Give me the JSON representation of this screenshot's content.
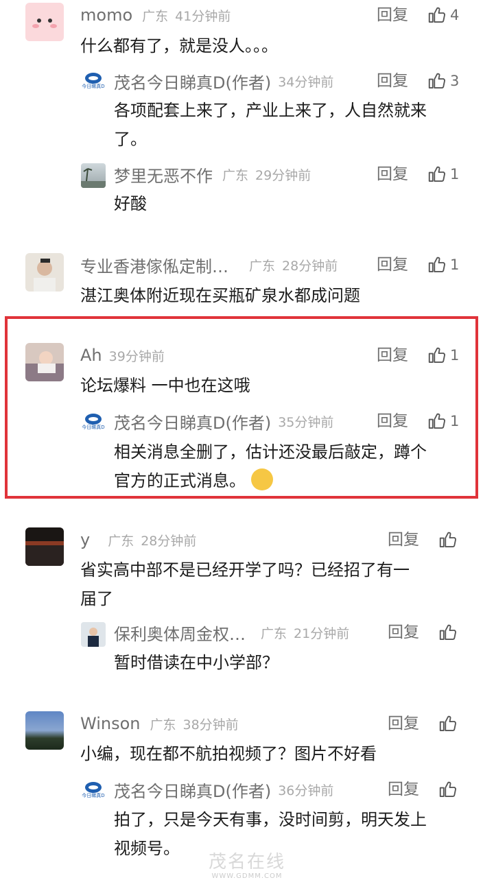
{
  "reply_label": "回复",
  "comments": [
    {
      "user": "momo",
      "region": "广东",
      "time": "41分钟前",
      "likes": "4",
      "text": "什么都有了，就是没人。。。",
      "replies": [
        {
          "user": "茂名今日睇真D(作者)",
          "region": "",
          "time": "34分钟前",
          "likes": "3",
          "text_line1": "各项配套上来了，产业上来了，人自然就来",
          "text_line2": "了。"
        },
        {
          "user": "梦里无恶不作",
          "region": "广东",
          "time": "29分钟前",
          "likes": "1",
          "text": "好酸"
        }
      ]
    },
    {
      "user": "专业香港傢俬定制…",
      "region": "广东",
      "time": "28分钟前",
      "likes": "1",
      "text": "湛江奥体附近现在买瓶矿泉水都成问题"
    },
    {
      "user": "Ah",
      "region": "",
      "time": "39分钟前",
      "likes": "1",
      "text": "论坛爆料 一中也在这哦",
      "replies": [
        {
          "user": "茂名今日睇真D(作者)",
          "region": "",
          "time": "35分钟前",
          "likes": "1",
          "text_line1": "相关消息全删了，估计还没最后敲定，蹲个",
          "text_line2": "官方的正式消息。"
        }
      ]
    },
    {
      "user": "y",
      "region": "广东",
      "time": "28分钟前",
      "likes": "",
      "text_line1": "省实高中部不是已经开学了吗？已经招了有一",
      "text_line2": "届了",
      "replies": [
        {
          "user": "保利奥体周金权…",
          "region": "广东",
          "time": "21分钟前",
          "likes": "",
          "text": "暂时借读在中小学部？"
        }
      ]
    },
    {
      "user": "Winson",
      "region": "广东",
      "time": "38分钟前",
      "likes": "",
      "text": "小编，现在都不航拍视频了？图片不好看",
      "replies": [
        {
          "user": "茂名今日睇真D(作者)",
          "region": "",
          "time": "36分钟前",
          "likes": "",
          "text_line1": "拍了，只是今天有事，没时间剪，明天发上",
          "text_line2": "视频号。"
        }
      ]
    }
  ],
  "author_logo_caption": "今日睇真D",
  "watermark": {
    "main": "茂名在线",
    "sub": "WWW.GDMM.COM"
  },
  "colors": {
    "highlight_border": "#e0333a",
    "author_logo": "#1f5fb0"
  }
}
